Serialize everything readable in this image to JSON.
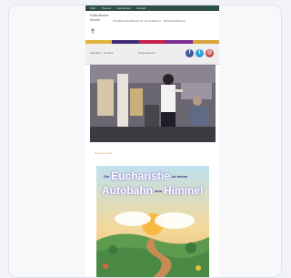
{
  "topbar": {
    "links": [
      "Start",
      "Themen",
      "Gemeinden",
      "Kontakt"
    ]
  },
  "logo": {
    "line1": "Katholische",
    "line2": "Kirche"
  },
  "tagline": "PFARREIVERBUND ST. ELISABETH · BRANDENBURG",
  "colors": {
    "topbar": "#2f4f43",
    "band": [
      "#e0b43a",
      "#3f2c76",
      "#c4204a",
      "#7a2e8e",
      "#d7a33a"
    ],
    "facebook": "#3b5a9a",
    "twitter": "#2ea1d8",
    "instagram": "#c54a4a"
  },
  "nav": {
    "left": "Aktuelles · Termine",
    "mid": "Gottesdienste"
  },
  "social": [
    {
      "name": "facebook-icon",
      "glyph": "f"
    },
    {
      "name": "twitter-icon",
      "glyph": "t"
    },
    {
      "name": "instagram-icon",
      "glyph": "◎"
    }
  ],
  "section_label": "Neues im Juni",
  "poster": {
    "word1": "Die",
    "word2": "Eucharistie",
    "word3": "ist meine",
    "word4": "Autobahn",
    "word5": "zum",
    "word6": "Himmel"
  }
}
